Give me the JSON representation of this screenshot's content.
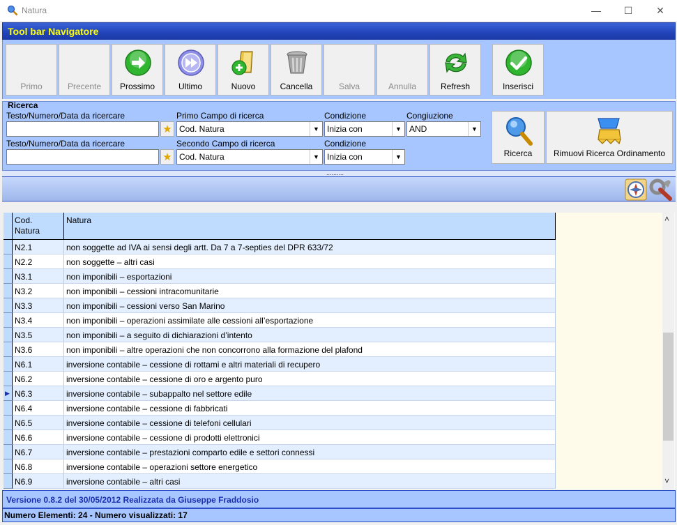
{
  "window": {
    "title": "Natura",
    "minimize": "—",
    "maximize": "☐",
    "close": "✕"
  },
  "toolbar": {
    "title": "Tool bar Navigatore",
    "buttons": [
      {
        "label": "Primo",
        "enabled": false,
        "icon": "first-icon"
      },
      {
        "label": "Precente",
        "enabled": false,
        "icon": "previous-icon"
      },
      {
        "label": "Prossimo",
        "enabled": true,
        "icon": "next-arrow-icon"
      },
      {
        "label": "Ultimo",
        "enabled": true,
        "icon": "last-fastforward-icon"
      },
      {
        "label": "Nuovo",
        "enabled": true,
        "icon": "new-document-icon"
      },
      {
        "label": "Cancella",
        "enabled": true,
        "icon": "trash-icon"
      },
      {
        "label": "Salva",
        "enabled": false,
        "icon": "save-icon"
      },
      {
        "label": "Annulla",
        "enabled": false,
        "icon": "undo-icon"
      },
      {
        "label": "Refresh",
        "enabled": true,
        "icon": "refresh-icon"
      },
      {
        "label": "Inserisci",
        "enabled": true,
        "icon": "checkmark-icon"
      }
    ]
  },
  "search": {
    "legend": "Ricerca",
    "text1_label": "Testo/Numero/Data da ricercare",
    "text1_value": "",
    "text2_label": "Testo/Numero/Data da ricercare",
    "text2_value": "",
    "field1_label": "Primo Campo di ricerca",
    "field1_value": "Cod. Natura",
    "field2_label": "Secondo Campo di ricerca",
    "field2_value": "Cod. Natura",
    "cond1_label": "Condizione",
    "cond1_value": "Inizia con",
    "cond2_label": "Condizione",
    "cond2_value": "Inizia con",
    "conj_label": "Congiuzione",
    "conj_value": "AND",
    "search_button": "Ricerca",
    "remove_button": "Rimuovi Ricerca Ordinamento",
    "splitter_dots": "..........",
    "star": "★",
    "dropdown_arrow": "▼"
  },
  "grid": {
    "columns": [
      "Cod.\nNatura",
      "Natura"
    ],
    "current_row_index": 10,
    "current_row_marker": "▶",
    "rows": [
      [
        "N2.1",
        "non soggette ad IVA ai sensi degli artt. Da 7 a 7-septies del DPR 633/72"
      ],
      [
        "N2.2",
        "non soggette – altri casi"
      ],
      [
        "N3.1",
        "non imponibili – esportazioni"
      ],
      [
        "N3.2",
        "non imponibili – cessioni intracomunitarie"
      ],
      [
        "N3.3",
        "non imponibili – cessioni verso San Marino"
      ],
      [
        "N3.4",
        "non imponibili – operazioni assimilate alle cessioni all’esportazione"
      ],
      [
        "N3.5",
        "non imponibili – a seguito di dichiarazioni d’intento"
      ],
      [
        "N3.6",
        "non imponibili – altre operazioni che non concorrono alla formazione del plafond"
      ],
      [
        "N6.1",
        "inversione contabile – cessione di rottami e altri materiali di recupero"
      ],
      [
        "N6.2",
        "inversione contabile – cessione di oro e argento puro"
      ],
      [
        "N6.3",
        "inversione contabile – subappalto nel settore edile"
      ],
      [
        "N6.4",
        "inversione contabile – cessione di fabbricati"
      ],
      [
        "N6.5",
        "inversione contabile – cessione di telefoni cellulari"
      ],
      [
        "N6.6",
        "inversione contabile – cessione di prodotti elettronici"
      ],
      [
        "N6.7",
        "inversione contabile – prestazioni comparto edile e settori connessi"
      ],
      [
        "N6.8",
        "inversione contabile – operazioni settore energetico"
      ],
      [
        "N6.9",
        "inversione contabile – altri casi"
      ]
    ]
  },
  "scrollbar": {
    "up": "˄",
    "down": "˅"
  },
  "status": {
    "version": "Versione 0.8.2 del 30/05/2012 Realizzata da Giuseppe Fraddosio",
    "counts": "Numero Elementi: 24 - Numero visualizzati: 17"
  },
  "colors": {
    "header_blue": "#2244b8",
    "title_yellow": "#ffff00",
    "panel_blue": "#a7c6ff",
    "grid_row": "#e3efff"
  }
}
